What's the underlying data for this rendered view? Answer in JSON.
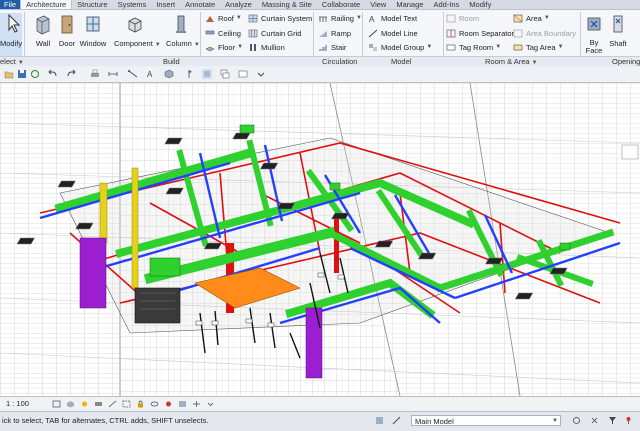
{
  "tabs": [
    "File",
    "Architecture",
    "Structure",
    "Systems",
    "Insert",
    "Annotate",
    "Analyze",
    "Massing & Site",
    "Collaborate",
    "View",
    "Manage",
    "Add-Ins",
    "Modify"
  ],
  "active_tab": "Architecture",
  "ribbon": {
    "modify": "Modify",
    "select": "elect",
    "build": {
      "wall": "Wall",
      "door": "Door",
      "window": "Window",
      "component": "Component",
      "column": "Column",
      "roof": "Roof",
      "ceiling": "Ceiling",
      "floor": "Floor",
      "curtain_system": "Curtain System",
      "curtain_grid": "Curtain Grid",
      "mullion": "Mullion",
      "label": "Build"
    },
    "circulation": {
      "railing": "Railing",
      "ramp": "Ramp",
      "stair": "Stair",
      "label": "Circulation"
    },
    "model": {
      "model_text": "Model Text",
      "model_line": "Model Line",
      "model_group": "Model Group",
      "label": "Model"
    },
    "room_area": {
      "room": "Room",
      "room_separator": "Room Separator",
      "tag_room": "Tag Room",
      "area": "Area",
      "area_boundary": "Area Boundary",
      "tag_area": "Tag Area",
      "label": "Room & Area"
    },
    "opening": {
      "by_face_1": "By",
      "by_face_2": "Face",
      "shaft": "Shaft",
      "label": "Openings"
    }
  },
  "viewbar": {
    "scale": "1 : 100"
  },
  "statusbar": {
    "message": "ick to select, TAB for alternates, CTRL adds, SHIFT unselects.",
    "workset": "Main Model"
  },
  "colors": {
    "duct_green": "#2fd12f",
    "duct_blue": "#2340ff",
    "pipe_red": "#e01010",
    "shaft_purple": "#9b1fd0",
    "shaft_yellow": "#e6d21c",
    "equipment_orange": "#ff8c1a",
    "file_tab": "#1f5fa8"
  }
}
